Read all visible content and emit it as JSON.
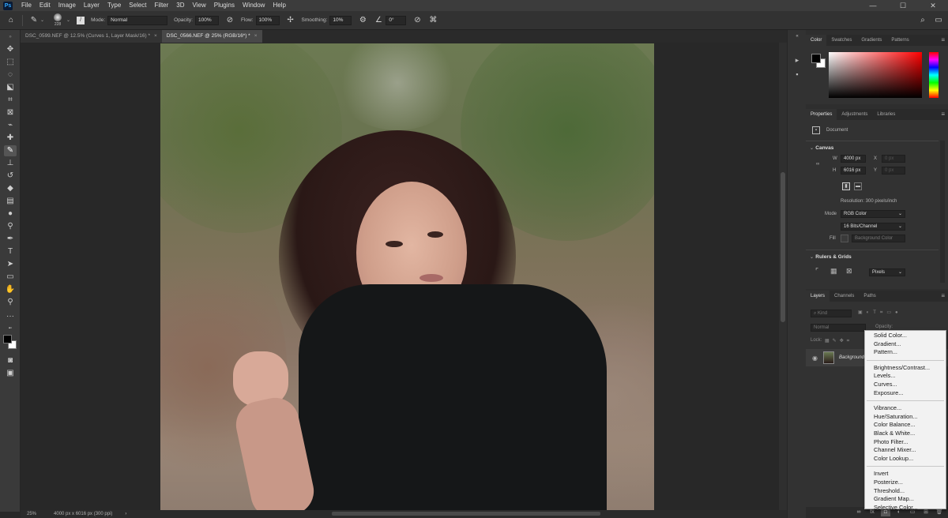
{
  "app": {
    "logo": "Ps"
  },
  "menu": [
    "File",
    "Edit",
    "Image",
    "Layer",
    "Type",
    "Select",
    "Filter",
    "3D",
    "View",
    "Plugins",
    "Window",
    "Help"
  ],
  "window_controls": {
    "minimize": "—",
    "maximize": "☐",
    "close": "✕"
  },
  "options": {
    "brush_size": "228",
    "mode_label": "Mode:",
    "mode_value": "Normal",
    "opacity_label": "Opacity:",
    "opacity_value": "100%",
    "flow_label": "Flow:",
    "flow_value": "100%",
    "smoothing_label": "Smoothing:",
    "smoothing_value": "10%",
    "angle_value": "0°"
  },
  "tabs": [
    {
      "label": "DSC_0599.NEF @ 12.5% (Curves 1, Layer Mask/16) *",
      "close": "×"
    },
    {
      "label": "DSC_0566.NEF @ 25% (RGB/16*) *",
      "close": "×"
    }
  ],
  "status": {
    "zoom": "25%",
    "doc_info": "4000 px x 6016 px (300 ppi)",
    "arrow": "›"
  },
  "color_panel": {
    "tabs": [
      "Color",
      "Swatches",
      "Gradients",
      "Patterns"
    ]
  },
  "properties_panel": {
    "tabs": [
      "Properties",
      "Adjustments",
      "Libraries"
    ],
    "doc_label": "Document",
    "canvas_title": "Canvas",
    "w_label": "W",
    "w_value": "4000 px",
    "h_label": "H",
    "h_value": "6016 px",
    "x_label": "X",
    "x_value": "0 px",
    "y_label": "Y",
    "y_value": "0 px",
    "resolution": "Resolution: 300 pixels/inch",
    "mode_label": "Mode",
    "mode_value": "RGB Color",
    "bits_value": "16 Bits/Channel",
    "fill_label": "Fill",
    "fill_value": "Background Color",
    "rulers_title": "Rulers & Grids",
    "units_value": "Pixels"
  },
  "layers_panel": {
    "tabs": [
      "Layers",
      "Channels",
      "Paths"
    ],
    "search_placeholder": "Kind",
    "blend_value": "Normal",
    "opacity_label": "Opacity:",
    "lock_label": "Lock:",
    "layer_name": "Background"
  },
  "context_menu": {
    "groups": [
      [
        "Solid Color...",
        "Gradient...",
        "Pattern..."
      ],
      [
        "Brightness/Contrast...",
        "Levels...",
        "Curves...",
        "Exposure..."
      ],
      [
        "Vibrance...",
        "Hue/Saturation...",
        "Color Balance...",
        "Black & White...",
        "Photo Filter...",
        "Channel Mixer...",
        "Color Lookup..."
      ],
      [
        "Invert",
        "Posterize...",
        "Threshold...",
        "Gradient Map...",
        "Selective Color..."
      ]
    ]
  },
  "colors": {
    "accent": "#31a8ff",
    "foreground": "#000000",
    "background": "#ffffff",
    "picker_hue": "#ff0000"
  }
}
